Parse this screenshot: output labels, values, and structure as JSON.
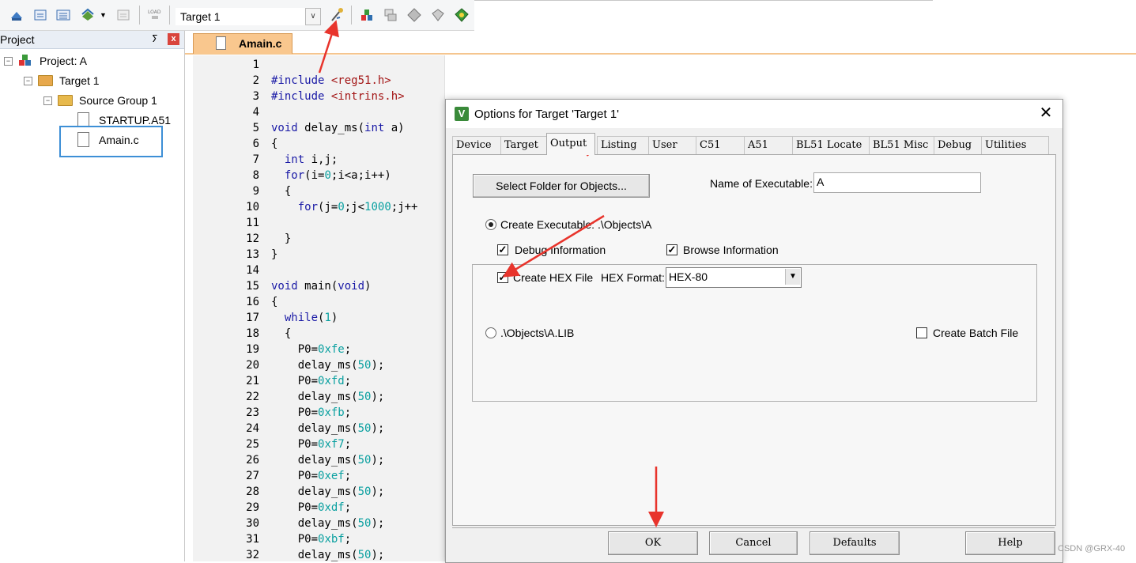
{
  "toolbar": {
    "target_value": "Target 1",
    "icons": [
      "translate-icon",
      "build-icon",
      "rebuild-icon",
      "batch-build-icon",
      "stop-build-icon",
      "download-load-icon",
      "target-options-icon",
      "manage-project-items-icon",
      "select-packs-icon",
      "manage-rte-icon",
      "pack-installer-icon",
      "components-icon"
    ]
  },
  "project_panel": {
    "title": "Project",
    "pin_glyph": "ⵢ",
    "close_glyph": "x",
    "tree": {
      "project": "Project: A",
      "target": "Target 1",
      "group": "Source Group 1",
      "files": [
        "STARTUP.A51",
        "Amain.c"
      ]
    }
  },
  "editor": {
    "tab_label": "Amain.c",
    "line_numbers": [
      "1",
      "2",
      "3",
      "4",
      "5",
      "6",
      "7",
      "8",
      "9",
      "10",
      "11",
      "12",
      "13",
      "14",
      "15",
      "16",
      "17",
      "18",
      "19",
      "20",
      "21",
      "22",
      "23",
      "24",
      "25",
      "26",
      "27",
      "28",
      "29",
      "30",
      "31",
      "32"
    ]
  },
  "dialog": {
    "title": "Options for Target 'Target 1'",
    "close_glyph": "✕",
    "tabs": [
      "Device",
      "Target",
      "Output",
      "Listing",
      "User",
      "C51",
      "A51",
      "BL51 Locate",
      "BL51 Misc",
      "Debug",
      "Utilities"
    ],
    "active_tab": "Output",
    "select_folder_label": "Select Folder for Objects...",
    "name_exe_label": "Name of Executable:",
    "name_exe_value": "A",
    "create_exe_label": "Create Executable:  .\\Objects\\A",
    "debug_info_label": "Debug Information",
    "browse_info_label": "Browse Information",
    "create_hex_label": "Create HEX File",
    "hex_format_label": "HEX Format:",
    "hex_format_value": "HEX-80",
    "lib_label": ".\\Objects\\A.LIB",
    "batch_label": "Create Batch File",
    "ok_label": "OK",
    "cancel_label": "Cancel",
    "defaults_label": "Defaults",
    "help_label": "Help"
  },
  "watermark": "CSDN @GRX-40",
  "colors": {
    "tab_accent": "#f9c78e",
    "highlight_box": "#3d8fd6",
    "annotation_arrow": "#e8342c",
    "keyword": "#1a1aa6"
  }
}
